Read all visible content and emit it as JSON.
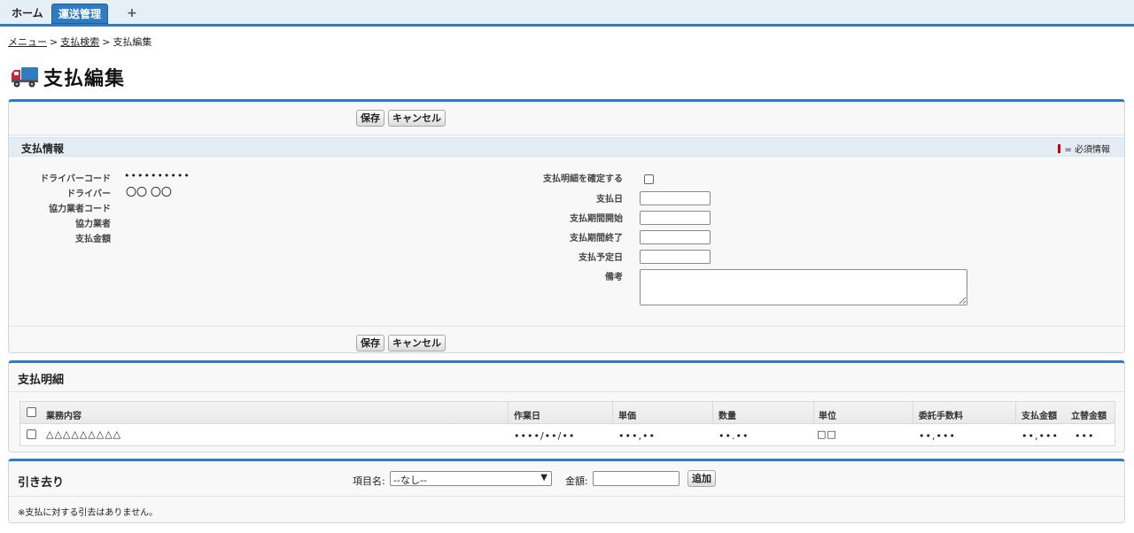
{
  "tabs": {
    "home": "ホーム",
    "transport": "運送管理",
    "add": "+"
  },
  "breadcrumb": {
    "menu": "メニュー",
    "sep1": ">",
    "search": "支払検索",
    "sep2": ">",
    "current": "支払編集"
  },
  "page": {
    "title": "支払編集",
    "icon": "truck-icon"
  },
  "buttons": {
    "save": "保存",
    "cancel": "キャンセル",
    "add": "追加"
  },
  "payment_info": {
    "section_title": "支払情報",
    "required_legend": "= 必須情報",
    "left": [
      {
        "label": "ドライバーコード",
        "value": "••••••••••"
      },
      {
        "label": "ドライバー",
        "value": "〇〇 〇〇"
      },
      {
        "label": "協力業者コード",
        "value": ""
      },
      {
        "label": "協力業者",
        "value": ""
      },
      {
        "label": "支払金額",
        "value": ""
      }
    ],
    "right": {
      "confirm_label": "支払明細を確定する",
      "date_label": "支払日",
      "period_start_label": "支払期間開始",
      "period_end_label": "支払期間終了",
      "scheduled_label": "支払予定日",
      "note_label": "備考"
    }
  },
  "details": {
    "title": "支払明細",
    "headers": [
      "業務内容",
      "作業日",
      "単価",
      "数量",
      "単位",
      "委託手数料",
      "支払金額",
      "立替金額"
    ],
    "rows": [
      {
        "task": "△△△△△△△△△",
        "date": "••••/••/••",
        "unit_price": "•••,••",
        "quantity": "••.••",
        "unit": "□□",
        "commission": "••,•••",
        "amount": "••,•••",
        "advance": "•••"
      }
    ]
  },
  "deductions": {
    "title": "引き去り",
    "item_label": "項目名:",
    "item_selected": "--なし--",
    "amount_label": "金額:",
    "note": "※支払に対する引去はありません。"
  },
  "colors": {
    "accent": "#2f7cc0",
    "required": "#cc0000",
    "section_bg": "#e4ecf4"
  }
}
